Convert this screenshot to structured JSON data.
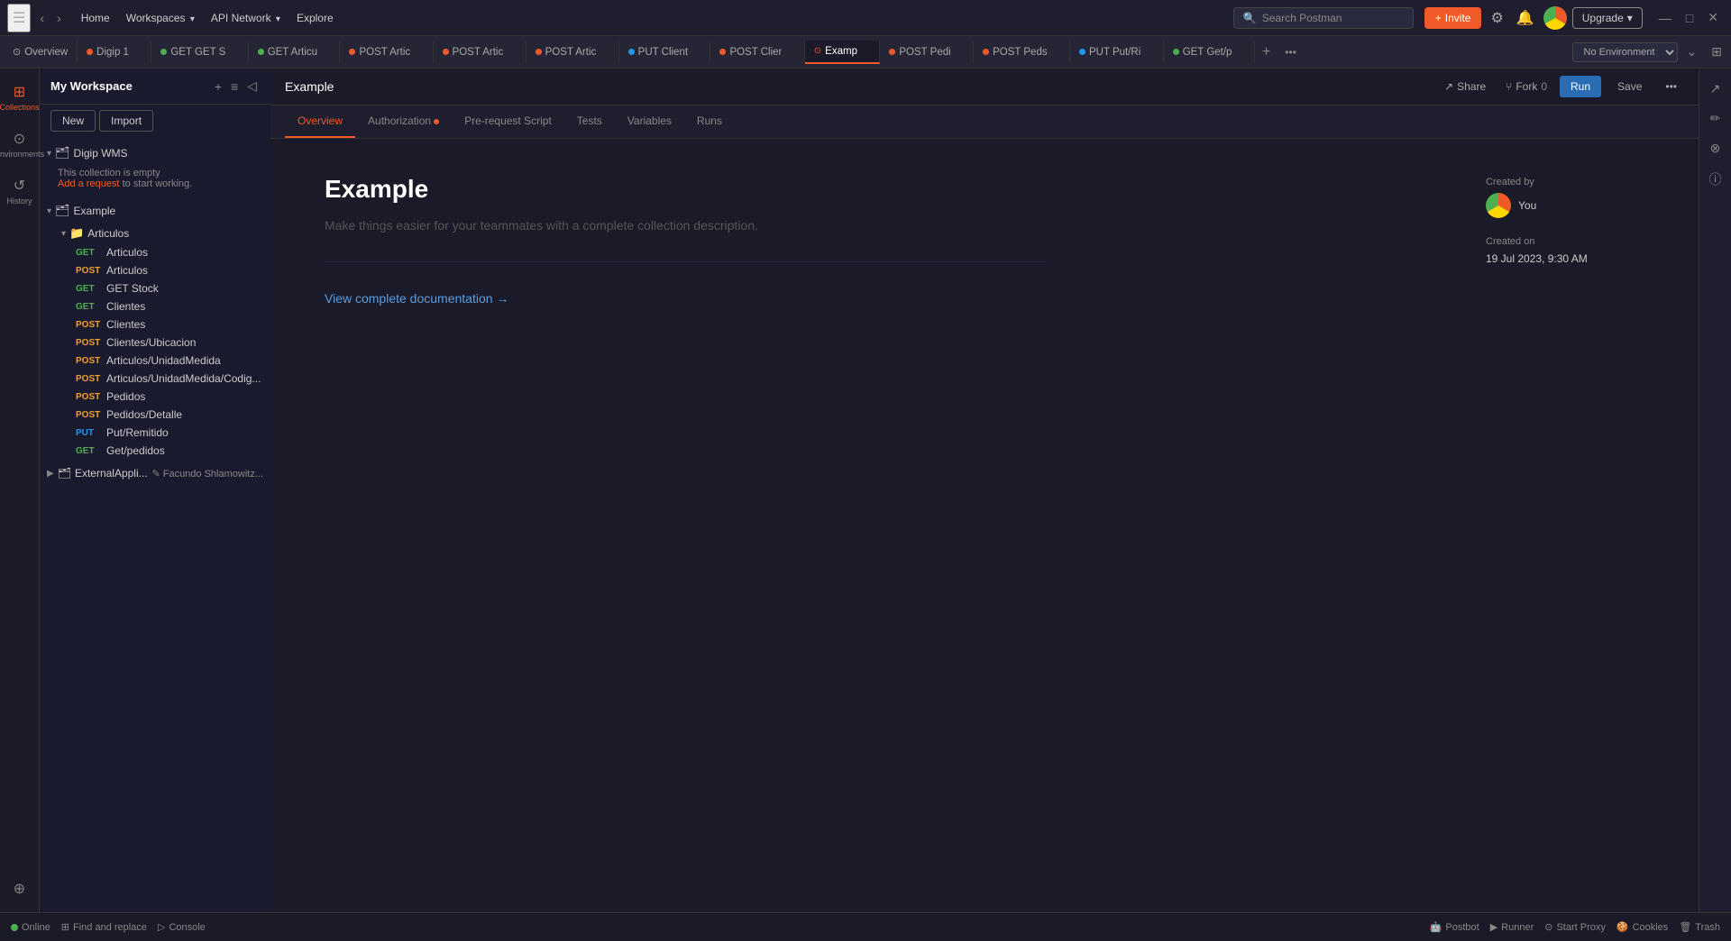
{
  "topbar": {
    "nav_items": [
      "Home",
      "Workspaces",
      "API Network",
      "Explore"
    ],
    "nav_items_with_chevron": [
      false,
      true,
      true,
      false
    ],
    "search_placeholder": "Search Postman",
    "invite_label": "Invite",
    "upgrade_label": "Upgrade"
  },
  "tabbar": {
    "tabs": [
      {
        "id": "overview",
        "label": "Overview",
        "type": "overview",
        "method": null,
        "active": false
      },
      {
        "id": "digip1",
        "label": "Digip 1",
        "type": "request",
        "method": "overview",
        "active": false
      },
      {
        "id": "get-get-s",
        "label": "GET GET S",
        "type": "request",
        "method": "GET",
        "active": false
      },
      {
        "id": "get-articu",
        "label": "GET Articu",
        "type": "request",
        "method": "GET",
        "active": false
      },
      {
        "id": "post-artic",
        "label": "POST Artic",
        "type": "request",
        "method": "POST",
        "active": false
      },
      {
        "id": "post-artic2",
        "label": "POST Artic",
        "type": "request",
        "method": "POST",
        "active": false
      },
      {
        "id": "post-artic3",
        "label": "POST Artic",
        "type": "request",
        "method": "POST",
        "active": false
      },
      {
        "id": "put-client",
        "label": "PUT Client",
        "type": "request",
        "method": "PUT",
        "active": false
      },
      {
        "id": "post-clier",
        "label": "POST Clier",
        "type": "request",
        "method": "POST",
        "active": false
      },
      {
        "id": "examp",
        "label": "Examp",
        "type": "request",
        "method": "collection",
        "active": true
      },
      {
        "id": "post-pedi",
        "label": "POST Pedi",
        "type": "request",
        "method": "POST",
        "active": false
      },
      {
        "id": "post-peds",
        "label": "POST Peds",
        "type": "request",
        "method": "POST",
        "active": false
      },
      {
        "id": "put-put-r",
        "label": "PUT Put/Ri",
        "type": "request",
        "method": "PUT",
        "active": false
      },
      {
        "id": "get-getp",
        "label": "GET Get/p",
        "type": "request",
        "method": "GET",
        "active": false
      }
    ],
    "env_placeholder": "No Environment"
  },
  "sidebar": {
    "workspace_name": "My Workspace",
    "new_label": "New",
    "import_label": "Import",
    "collections": [
      {
        "id": "digip-wms",
        "name": "Digip WMS",
        "expanded": true,
        "empty": true,
        "empty_text": "This collection is empty",
        "add_request_text": "Add a request",
        "to_start_text": " to start working."
      },
      {
        "id": "example",
        "name": "Example",
        "expanded": true,
        "folders": [
          {
            "id": "articulos",
            "name": "Articulos",
            "expanded": true,
            "requests": [
              {
                "method": "GET",
                "name": "Articulos"
              },
              {
                "method": "POST",
                "name": "Articulos"
              },
              {
                "method": "GET",
                "name": "GET Stock"
              },
              {
                "method": "GET",
                "name": "Clientes"
              },
              {
                "method": "POST",
                "name": "Clientes"
              },
              {
                "method": "POST",
                "name": "Clientes/Ubicacion"
              },
              {
                "method": "POST",
                "name": "Articulos/UnidadMedida"
              },
              {
                "method": "POST",
                "name": "Articulos/UnidadMedida/Codig..."
              },
              {
                "method": "POST",
                "name": "Pedidos"
              },
              {
                "method": "POST",
                "name": "Pedidos/Detalle"
              },
              {
                "method": "PUT",
                "name": "Put/Remitido"
              },
              {
                "method": "GET",
                "name": "Get/pedidos"
              }
            ]
          }
        ]
      }
    ],
    "external_apps": [
      {
        "name": "ExternalAppli...",
        "user": "✎ Facundo Shlamowitz..."
      }
    ]
  },
  "content": {
    "collection_title": "Example",
    "share_label": "Share",
    "fork_label": "Fork",
    "fork_count": "0",
    "run_label": "Run",
    "save_label": "Save",
    "tabs": [
      {
        "id": "overview",
        "label": "Overview",
        "active": true,
        "has_dot": false
      },
      {
        "id": "authorization",
        "label": "Authorization",
        "active": false,
        "has_dot": true
      },
      {
        "id": "pre-request",
        "label": "Pre-request Script",
        "active": false,
        "has_dot": false
      },
      {
        "id": "tests",
        "label": "Tests",
        "active": false,
        "has_dot": false
      },
      {
        "id": "variables",
        "label": "Variables",
        "active": false,
        "has_dot": false
      },
      {
        "id": "runs",
        "label": "Runs",
        "active": false,
        "has_dot": false
      }
    ],
    "collection_name": "Example",
    "description_placeholder": "Make things easier for your teammates with a complete collection description.",
    "view_docs_label": "View complete documentation →",
    "created_by_label": "Created by",
    "creator_name": "You",
    "created_on_label": "Created on",
    "created_date": "19 Jul 2023, 9:30 AM"
  },
  "bottombar": {
    "status_label": "Online",
    "find_replace_label": "Find and replace",
    "console_label": "Console",
    "postbot_label": "Postbot",
    "runner_label": "Runner",
    "start_proxy_label": "Start Proxy",
    "cookies_label": "Cookies",
    "trash_label": "Trash"
  }
}
